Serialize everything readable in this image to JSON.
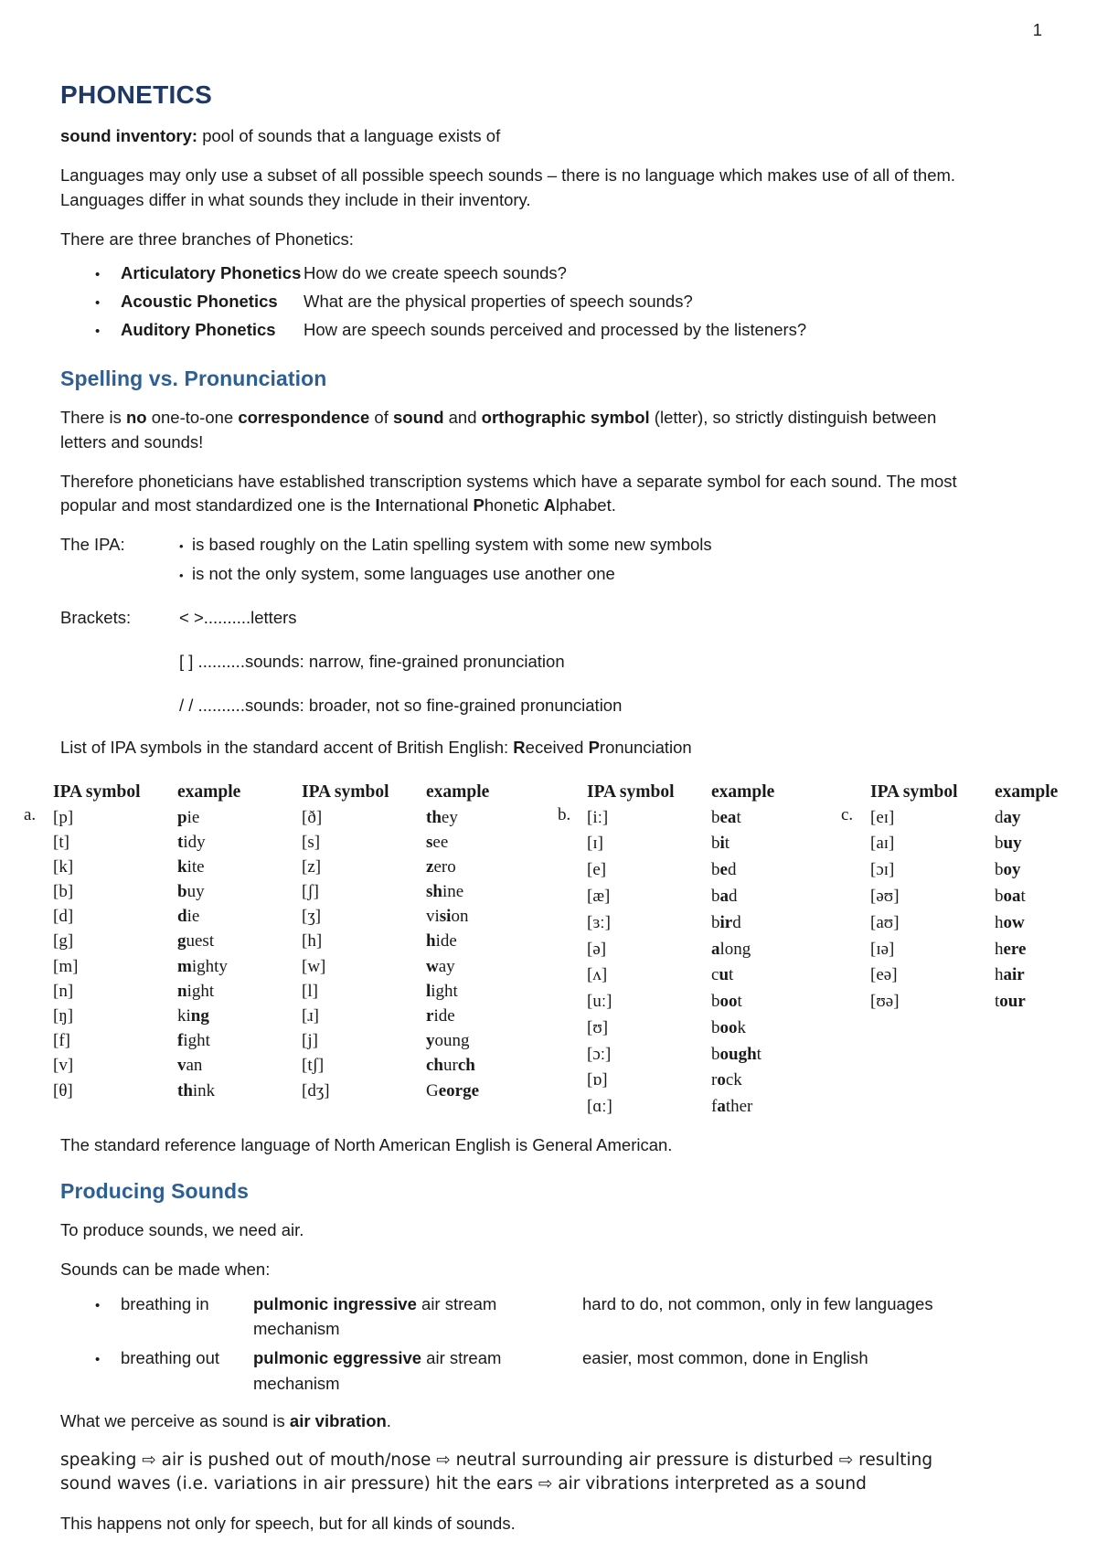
{
  "page": {
    "number": "1"
  },
  "title": "PHONETICS",
  "intro": {
    "sound_inventory_term": "sound inventory:",
    "sound_inventory_def": " pool of sounds that a language exists of",
    "paragraph1": "Languages may only use a subset of all possible speech sounds – there is no language which makes use of all of them. Languages differ in what sounds they include in their inventory.",
    "branches_intro": "There are three branches of Phonetics:"
  },
  "branches": [
    {
      "bullet": "•",
      "term": "Articulatory Phonetics",
      "desc": "How do we create speech sounds?"
    },
    {
      "bullet": "•",
      "term": "Acoustic Phonetics",
      "desc": "What are the physical properties of speech sounds?"
    },
    {
      "bullet": "•",
      "term": "Auditory Phonetics",
      "desc": "How are speech sounds perceived and processed by the listeners?"
    }
  ],
  "spelling": {
    "heading": "Spelling vs. Pronunciation",
    "p1_a": "There is ",
    "p1_no": "no",
    "p1_b": " one-to-one ",
    "p1_corr": "correspondence",
    "p1_c": " of ",
    "p1_sound": "sound",
    "p1_d": " and ",
    "p1_ortho": "orthographic symbol",
    "p1_e": " (letter), so strictly distinguish between letters and sounds!",
    "p2_a": "Therefore phoneticians have established transcription systems which have a separate symbol for each sound. The most popular and most standardized one is the ",
    "p2_I": "I",
    "p2_nternational": "nternational ",
    "p2_P": "P",
    "p2_honetic": "honetic ",
    "p2_A": "A",
    "p2_lphabet": "lphabet."
  },
  "ipa_about": {
    "label": "The IPA:",
    "bullet": "•",
    "line1": "is based roughly on the Latin spelling system with some new symbols",
    "line2": "is not the only system, some languages use another one"
  },
  "brackets": {
    "label": "Brackets:",
    "row1": "< >..........letters",
    "row2": "[ ] ..........sounds: narrow, fine-grained pronunciation",
    "row3": "/ / ..........sounds: broader, not so fine-grained pronunciation"
  },
  "list_intro": {
    "a": "List of IPA symbols in the standard accent of British English: ",
    "R": "R",
    "eceived": "eceived ",
    "P": "P",
    "ronunciation": "ronunciation"
  },
  "table": {
    "headers": {
      "symbol": "IPA symbol",
      "example": "example"
    },
    "group_labels": {
      "a": "a.",
      "b": "b.",
      "c": "c."
    },
    "groups": {
      "a_col1": [
        {
          "symbol": "[p]",
          "bold": "p",
          "rest": "ie"
        },
        {
          "symbol": "[t]",
          "bold": "t",
          "rest": "idy"
        },
        {
          "symbol": "[k]",
          "bold": "k",
          "rest": "ite"
        },
        {
          "symbol": "[b]",
          "bold": "b",
          "rest": "uy"
        },
        {
          "symbol": "[d]",
          "bold": "d",
          "rest": "ie"
        },
        {
          "symbol": "[g]",
          "bold": "g",
          "rest": "uest"
        },
        {
          "symbol": "[m]",
          "bold": "m",
          "rest": "ighty"
        },
        {
          "symbol": "[n]",
          "bold": "n",
          "rest": "ight"
        },
        {
          "symbol": "[ŋ]",
          "pre": "ki",
          "bold": "ng",
          "rest": ""
        },
        {
          "symbol": "[f]",
          "bold": "f",
          "rest": "ight"
        },
        {
          "symbol": "[v]",
          "bold": "v",
          "rest": "an"
        },
        {
          "symbol": "[θ]",
          "bold": "th",
          "rest": "ink"
        }
      ],
      "a_col2": [
        {
          "symbol": "[ð]",
          "bold": "th",
          "rest": "ey"
        },
        {
          "symbol": "[s]",
          "bold": "s",
          "rest": "ee"
        },
        {
          "symbol": "[z]",
          "bold": "z",
          "rest": "ero"
        },
        {
          "symbol": "[ʃ]",
          "bold": "sh",
          "rest": "ine"
        },
        {
          "symbol": "[ʒ]",
          "pre": "vi",
          "bold": "si",
          "rest": "on"
        },
        {
          "symbol": "[h]",
          "bold": "h",
          "rest": "ide"
        },
        {
          "symbol": "[w]",
          "bold": "w",
          "rest": "ay"
        },
        {
          "symbol": "[l]",
          "bold": "l",
          "rest": "ight"
        },
        {
          "symbol": "[ɹ]",
          "bold": "r",
          "rest": "ide"
        },
        {
          "symbol": "[j]",
          "bold": "y",
          "rest": "oung"
        },
        {
          "symbol": "[tʃ]",
          "bold": "ch",
          "rest": "ur",
          "post": "ch"
        },
        {
          "symbol": "[dʒ]",
          "pre": "G",
          "bold": "eor",
          "rest": "",
          "post": "ge"
        }
      ],
      "b": [
        {
          "symbol": "[iː]",
          "pre": "b",
          "bold": "ea",
          "rest": "t"
        },
        {
          "symbol": "[ɪ]",
          "pre": "b",
          "bold": "i",
          "rest": "t"
        },
        {
          "symbol": "[e]",
          "pre": "b",
          "bold": "e",
          "rest": "d"
        },
        {
          "symbol": "[æ]",
          "pre": "b",
          "bold": "a",
          "rest": "d"
        },
        {
          "symbol": "[ɜː]",
          "pre": "b",
          "bold": "ir",
          "rest": "d"
        },
        {
          "symbol": "[ə]",
          "pre": "",
          "bold": "a",
          "rest": "long"
        },
        {
          "symbol": "[ʌ]",
          "pre": "c",
          "bold": "u",
          "rest": "t"
        },
        {
          "symbol": "[uː]",
          "pre": "b",
          "bold": "oo",
          "rest": "t"
        },
        {
          "symbol": "[ʊ]",
          "pre": "b",
          "bold": "oo",
          "rest": "k"
        },
        {
          "symbol": "[ɔː]",
          "pre": "b",
          "bold": "ough",
          "rest": "t"
        },
        {
          "symbol": "[ɒ]",
          "pre": "r",
          "bold": "o",
          "rest": "ck"
        },
        {
          "symbol": "[ɑː]",
          "pre": "f",
          "bold": "a",
          "rest": "ther"
        }
      ],
      "c": [
        {
          "symbol": "[eɪ]",
          "pre": "d",
          "bold": "ay",
          "rest": ""
        },
        {
          "symbol": "[aɪ]",
          "pre": "b",
          "bold": "uy",
          "rest": ""
        },
        {
          "symbol": "[ɔɪ]",
          "pre": "b",
          "bold": "oy",
          "rest": ""
        },
        {
          "symbol": "[əʊ]",
          "pre": "b",
          "bold": "oa",
          "rest": "t"
        },
        {
          "symbol": "[aʊ]",
          "pre": "h",
          "bold": "ow",
          "rest": ""
        },
        {
          "symbol": "[ɪə]",
          "pre": "h",
          "bold": "ere",
          "rest": ""
        },
        {
          "symbol": "[eə]",
          "pre": "h",
          "bold": "air",
          "rest": ""
        },
        {
          "symbol": "[ʊə]",
          "pre": "t",
          "bold": "our",
          "rest": ""
        }
      ]
    }
  },
  "after_table": "The standard reference language of North American English is General American.",
  "producing": {
    "heading": "Producing Sounds",
    "p1": "To produce sounds, we need air.",
    "p2": "Sounds can be made when:",
    "rows": [
      {
        "bullet": "•",
        "c1": "breathing in",
        "c2_bold": "pulmonic ingressive",
        "c2_rest": " air stream mechanism",
        "c3": "hard to do, not common, only in few languages"
      },
      {
        "bullet": "•",
        "c1": "breathing out",
        "c2_bold": "pulmonic eggressive",
        "c2_rest": " air stream mechanism",
        "c3": "easier, most common, done in English"
      }
    ],
    "p3_a": "What we perceive as sound is ",
    "p3_bold": "air vibration",
    "p3_b": ".",
    "p4": "speaking ⇨ air is pushed out of mouth/nose ⇨ neutral surrounding air pressure is disturbed ⇨ resulting sound waves (i.e. variations in air pressure) hit the ears ⇨ air vibrations interpreted as a sound",
    "p5": "This happens not only for speech, but for all kinds of sounds."
  }
}
